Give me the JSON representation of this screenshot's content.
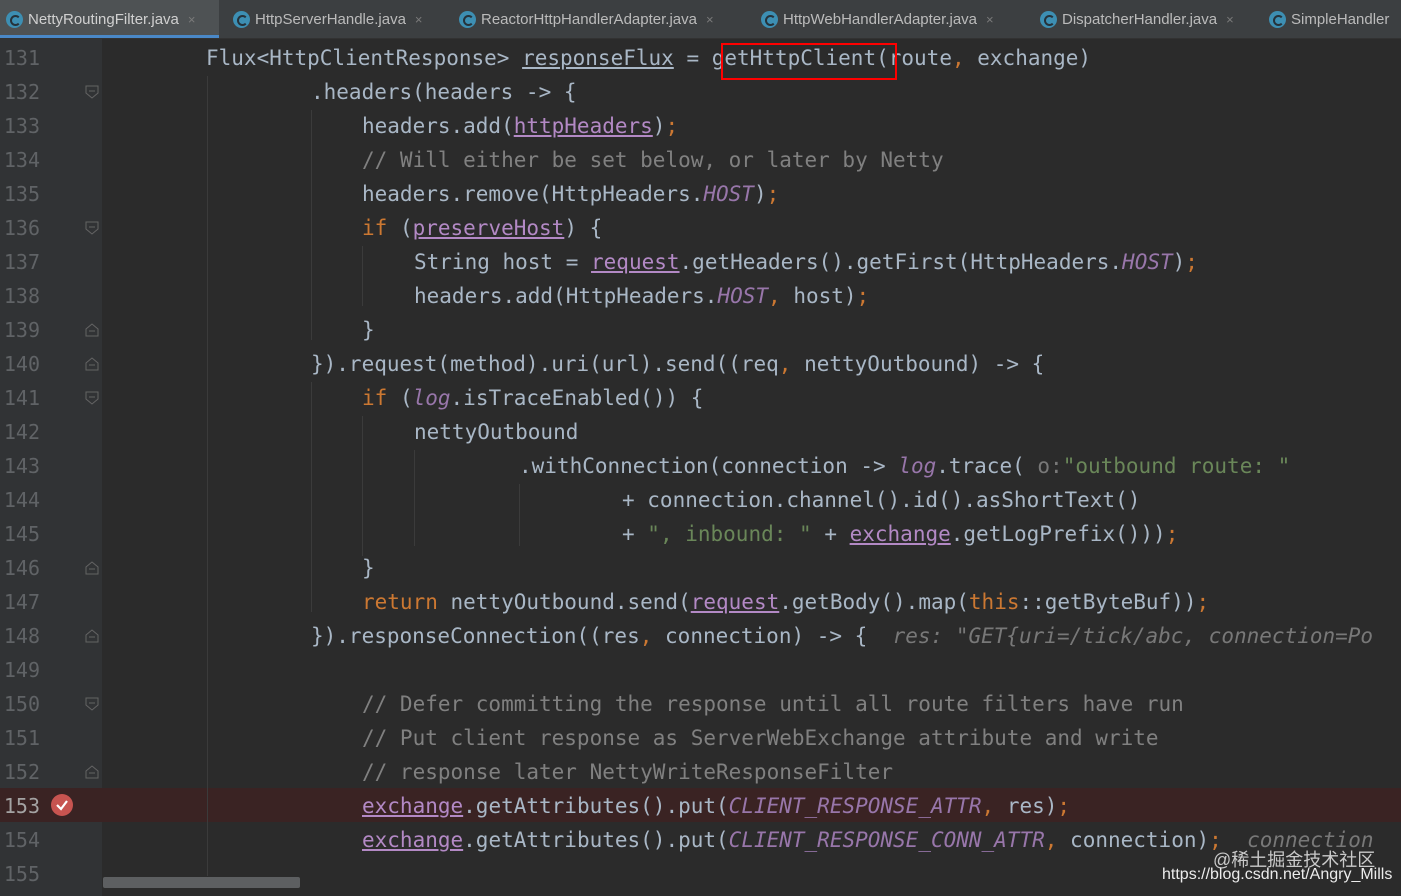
{
  "tabs": [
    {
      "label": "NettyRoutingFilter.java",
      "active": true
    },
    {
      "label": "HttpServerHandle.java",
      "active": false
    },
    {
      "label": "ReactorHttpHandlerAdapter.java",
      "active": false
    },
    {
      "label": "HttpWebHandlerAdapter.java",
      "active": false
    },
    {
      "label": "DispatcherHandler.java",
      "active": false
    },
    {
      "label": "SimpleHandler",
      "active": false
    }
  ],
  "close_glyph": "×",
  "editor": {
    "line_numbers": [
      "131",
      "132",
      "133",
      "134",
      "135",
      "136",
      "137",
      "138",
      "139",
      "140",
      "141",
      "142",
      "143",
      "144",
      "145",
      "146",
      "147",
      "148",
      "149",
      "150",
      "151",
      "152",
      "153",
      "154",
      "155"
    ],
    "breakpoint_line": "153",
    "highlighted_call": "getHttpClient",
    "inline_hint": "o:",
    "debug_value_148": "res: \"GET{uri=/tick/abc, connection=Po",
    "debug_value_154": "connection"
  },
  "watermark": {
    "brand": "@稀土掘金技术社区",
    "url": "https://blog.csdn.net/Angry_Mills"
  },
  "colors": {
    "background": "#2b2b2b",
    "keyword": "#cc7832",
    "string": "#6a8759",
    "comment": "#808080",
    "constant": "#9876aa",
    "highlight_box": "#ff0000",
    "breakpoint": "#c75450"
  },
  "icons": [
    "java-class-icon",
    "close-icon",
    "fold-marker-icon",
    "breakpoint-icon"
  ]
}
